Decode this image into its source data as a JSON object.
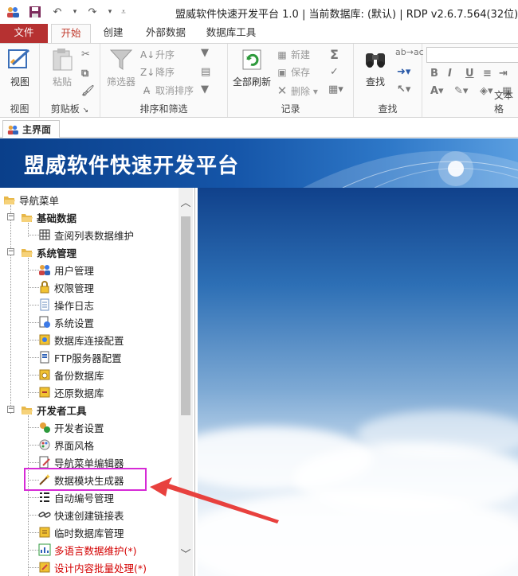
{
  "window": {
    "title": "盟威软件快速开发平台 1.0 | 当前数据库: (默认) | RDP v2.6.7.564(32位)"
  },
  "ribbon_tabs": [
    {
      "label": "文件"
    },
    {
      "label": "开始"
    },
    {
      "label": "创建"
    },
    {
      "label": "外部数据"
    },
    {
      "label": "数据库工具"
    }
  ],
  "ribbon": {
    "view": {
      "button": "视图",
      "group": "视图"
    },
    "clipboard": {
      "paste": "粘贴",
      "group": "剪贴板"
    },
    "sort": {
      "filter": "筛选器",
      "asc": "升序",
      "desc": "降序",
      "clear": "取消排序",
      "group": "排序和筛选"
    },
    "records": {
      "refresh": "全部刷新",
      "new": "新建",
      "save": "保存",
      "delete": "删除",
      "group": "记录"
    },
    "find": {
      "find": "查找",
      "group": "查找"
    },
    "text": {
      "group": "文本格"
    }
  },
  "doc_tab": {
    "label": "主界面"
  },
  "banner": {
    "title": "盟威软件快速开发平台"
  },
  "tree": {
    "root": "导航菜单",
    "items": [
      {
        "label": "基础数据"
      },
      {
        "label": "查阅列表数据维护"
      },
      {
        "label": "系统管理"
      },
      {
        "label": "用户管理"
      },
      {
        "label": "权限管理"
      },
      {
        "label": "操作日志"
      },
      {
        "label": "系统设置"
      },
      {
        "label": "数据库连接配置"
      },
      {
        "label": "FTP服务器配置"
      },
      {
        "label": "备份数据库"
      },
      {
        "label": "还原数据库"
      },
      {
        "label": "开发者工具"
      },
      {
        "label": "开发者设置"
      },
      {
        "label": "界面风格"
      },
      {
        "label": "导航菜单编辑器"
      },
      {
        "label": "数据模块生成器"
      },
      {
        "label": "自动编号管理"
      },
      {
        "label": "快速创建链接表"
      },
      {
        "label": "临时数据库管理"
      },
      {
        "label": "多语言数据维护(*)"
      },
      {
        "label": "设计内容批量处理(*)"
      }
    ]
  },
  "colors": {
    "file_tab": "#b63131",
    "active_tab_text": "#c0392b",
    "highlight": "#d62ad6",
    "arrow": "#e8413e",
    "red_item": "#d40000"
  }
}
